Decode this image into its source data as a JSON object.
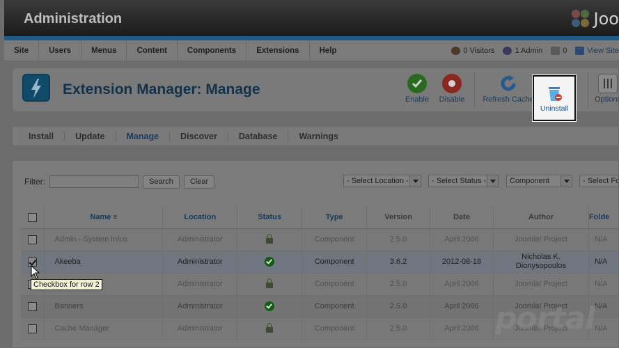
{
  "header": {
    "title": "Administration",
    "logo_text": "Joo"
  },
  "menu": {
    "items": [
      "Site",
      "Users",
      "Menus",
      "Content",
      "Components",
      "Extensions",
      "Help"
    ],
    "status": {
      "visitors": "0 Visitors",
      "admins": "1 Admin",
      "messages": "0",
      "view_site": "View Site"
    }
  },
  "toolbar": {
    "page_title": "Extension Manager: Manage",
    "buttons": {
      "enable": "Enable",
      "disable": "Disable",
      "refresh_cache": "Refresh Cache",
      "uninstall": "Uninstall",
      "options": "Options"
    }
  },
  "tabs": [
    "Install",
    "Update",
    "Manage",
    "Discover",
    "Database",
    "Warnings"
  ],
  "active_tab": "Manage",
  "filter": {
    "label": "Filter:",
    "value": "",
    "search_button": "Search",
    "clear_button": "Clear",
    "location_select": "- Select Location -",
    "status_select": "- Select Status -",
    "type_select": "Component",
    "folder_select": "- Select Fo"
  },
  "table": {
    "headers": [
      "Name",
      "Location",
      "Status",
      "Type",
      "Version",
      "Date",
      "Author",
      "Folde"
    ],
    "rows": [
      {
        "name": "Admin - System Infos",
        "location": "Administrator",
        "status": "locked",
        "type": "Component",
        "version": "2.5.0",
        "date": "April 2006",
        "author": "Joomla! Project",
        "folder": "N/A",
        "checked": false
      },
      {
        "name": "Akeeba",
        "location": "Administrator",
        "status": "enabled",
        "type": "Component",
        "version": "3.6.2",
        "date": "2012-08-18",
        "author": "Nicholas K. Dionysopoulos",
        "folder": "N/A",
        "checked": true
      },
      {
        "name": "",
        "location": "Administrator",
        "status": "locked",
        "type": "Component",
        "version": "2.5.0",
        "date": "April 2006",
        "author": "Joomla! Project",
        "folder": "N/A",
        "checked": false
      },
      {
        "name": "Banners",
        "location": "Administrator",
        "status": "enabled",
        "type": "Component",
        "version": "2.5.0",
        "date": "April 2006",
        "author": "Joomla! Project",
        "folder": "N/A",
        "checked": false
      },
      {
        "name": "Cache Manager",
        "location": "Administrator",
        "status": "locked",
        "type": "Component",
        "version": "2.5.0",
        "date": "April 2006",
        "author": "Joomla! Project",
        "folder": "N/A",
        "checked": false
      }
    ]
  },
  "tooltip": "Checkbox for row 2",
  "watermark": "portal",
  "colors": {
    "accent_blue": "#1d5d8e",
    "enable_green": "#3a8f2a",
    "disable_red": "#b6382e",
    "refresh_blue": "#2f74b5"
  }
}
